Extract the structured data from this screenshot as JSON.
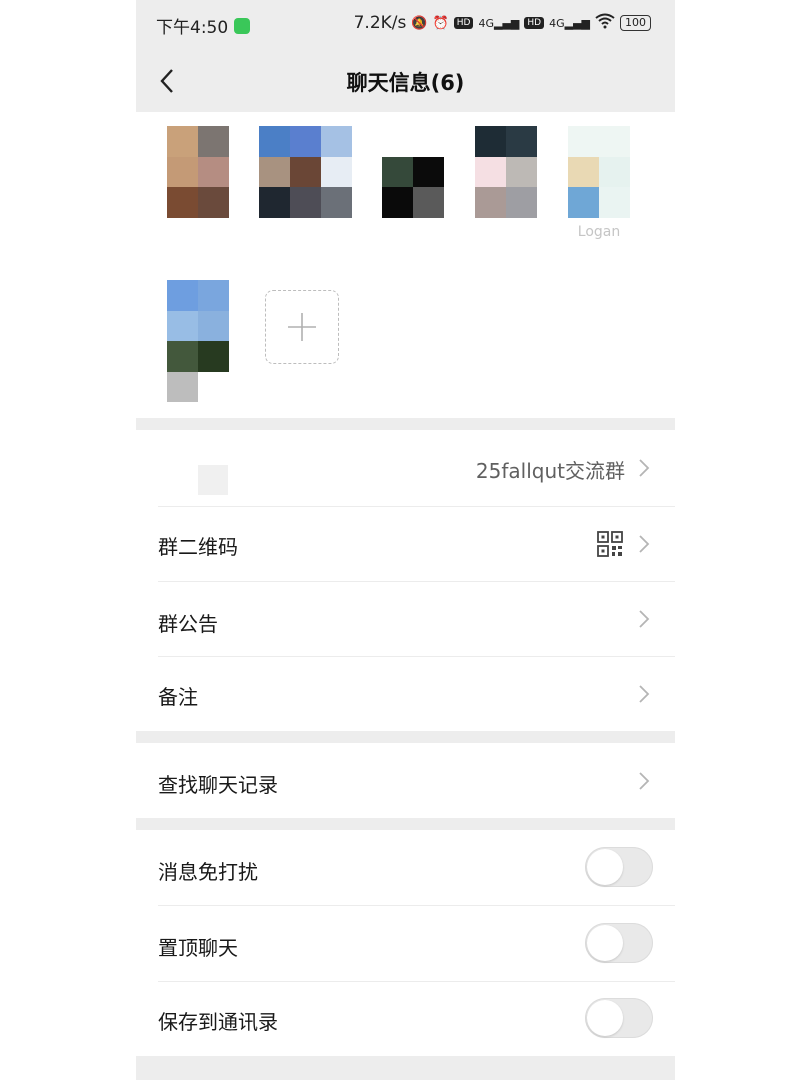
{
  "status_bar": {
    "time": "下午4:50",
    "speed": "7.2K/s",
    "net1": "4G",
    "net2": "4G",
    "hd": "HD",
    "battery": "100",
    "icons": [
      "mute-icon",
      "alarm-icon",
      "signal-icon",
      "wifi-icon",
      "battery-icon"
    ]
  },
  "nav": {
    "title": "聊天信息(6)",
    "back_icon": "chevron-left-icon"
  },
  "members": [
    {
      "name": "",
      "colors": [
        "#c9a17a",
        "#7c7571",
        "#c49a76",
        "#b58d82",
        "#7a4b32",
        "#6a4a3c"
      ]
    },
    {
      "name": "",
      "colors": [
        "#4b7fc6",
        "#5a7fcf",
        "#a5c1e4",
        "#a89280",
        "#6a4636",
        "#e7edf4",
        "#1f2730",
        "#4e4d56",
        "#6b7078"
      ]
    },
    {
      "name": "",
      "colors": [
        "#ffffff",
        "#ffffff",
        "#35493a",
        "#0b0b0b",
        "#0a0a0a",
        "#5a5a5a"
      ]
    },
    {
      "name": "",
      "colors": [
        "#1e2c35",
        "#2a3a44",
        "#f5dfe3",
        "#bdb9b5",
        "#aa9a96",
        "#9e9ea3"
      ]
    },
    {
      "name": "Logan",
      "colors": [
        "#eef6f3",
        "#eef6f3",
        "#e9d9b4",
        "#e6f2ef",
        "#6fa7d6",
        "#eaf4f2"
      ]
    },
    {
      "name": "",
      "colors": [
        "#6e9ee0",
        "#7aa6de",
        "#98bde5",
        "#8ab1de",
        "#43583c",
        "#273a20",
        "#bdbdbd",
        "#ffffff"
      ]
    }
  ],
  "group_name": {
    "value": "25fallqut交流群"
  },
  "rows": {
    "qr_code": "群二维码",
    "notice": "群公告",
    "remark": "备注",
    "search_history": "查找聊天记录",
    "mute": "消息免打扰",
    "pin": "置顶聊天",
    "save_contacts": "保存到通讯录"
  },
  "toggles": {
    "mute": false,
    "pin": false,
    "save_contacts": false
  },
  "colors": {
    "background_gray": "#ededed",
    "toggle_off": "#e9e9e9",
    "text_primary": "#191919"
  }
}
